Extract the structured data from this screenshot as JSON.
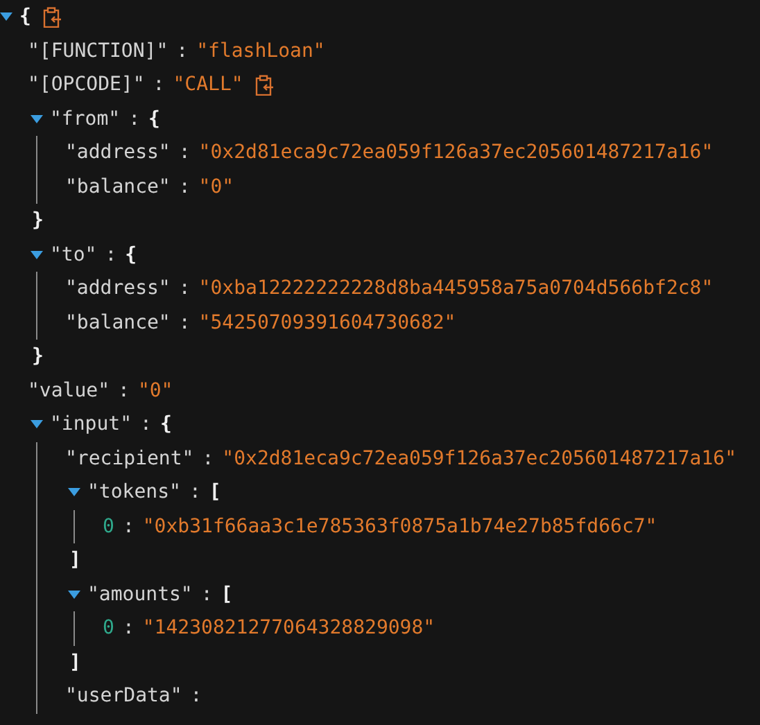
{
  "separator": ":",
  "root": {
    "open": "{",
    "expanded": true,
    "copyable": true,
    "children": [
      {
        "kind": "pair",
        "key": "\"[FUNCTION]\"",
        "value": "\"flashLoan\"",
        "copyable": false
      },
      {
        "kind": "pair",
        "key": "\"[OPCODE]\"",
        "value": "\"CALL\"",
        "copyable": true
      },
      {
        "kind": "branch",
        "key": "\"from\"",
        "open": "{",
        "close": "}",
        "expanded": true,
        "children": [
          {
            "kind": "pair",
            "key": "\"address\"",
            "value": "\"0x2d81eca9c72ea059f126a37ec205601487217a16\""
          },
          {
            "kind": "pair",
            "key": "\"balance\"",
            "value": "\"0\""
          }
        ]
      },
      {
        "kind": "branch",
        "key": "\"to\"",
        "open": "{",
        "close": "}",
        "expanded": true,
        "children": [
          {
            "kind": "pair",
            "key": "\"address\"",
            "value": "\"0xba12222222228d8ba445958a75a0704d566bf2c8\""
          },
          {
            "kind": "pair",
            "key": "\"balance\"",
            "value": "\"54250709391604730682\""
          }
        ]
      },
      {
        "kind": "pair",
        "key": "\"value\"",
        "value": "\"0\""
      },
      {
        "kind": "branch",
        "key": "\"input\"",
        "open": "{",
        "expanded": true,
        "children": [
          {
            "kind": "pair",
            "key": "\"recipient\"",
            "value": "\"0x2d81eca9c72ea059f126a37ec205601487217a16\""
          },
          {
            "kind": "branch",
            "key": "\"tokens\"",
            "open": "[",
            "close": "]",
            "expanded": true,
            "children": [
              {
                "kind": "item",
                "key": "0",
                "value": "\"0xb31f66aa3c1e785363f0875a1b74e27b85fd66c7\""
              }
            ]
          },
          {
            "kind": "branch",
            "key": "\"amounts\"",
            "open": "[",
            "close": "]",
            "expanded": true,
            "children": [
              {
                "kind": "item",
                "key": "0",
                "value": "\"14230821277064328829098\""
              }
            ]
          },
          {
            "kind": "wrapped",
            "key": "\"userData\""
          }
        ]
      }
    ]
  }
}
